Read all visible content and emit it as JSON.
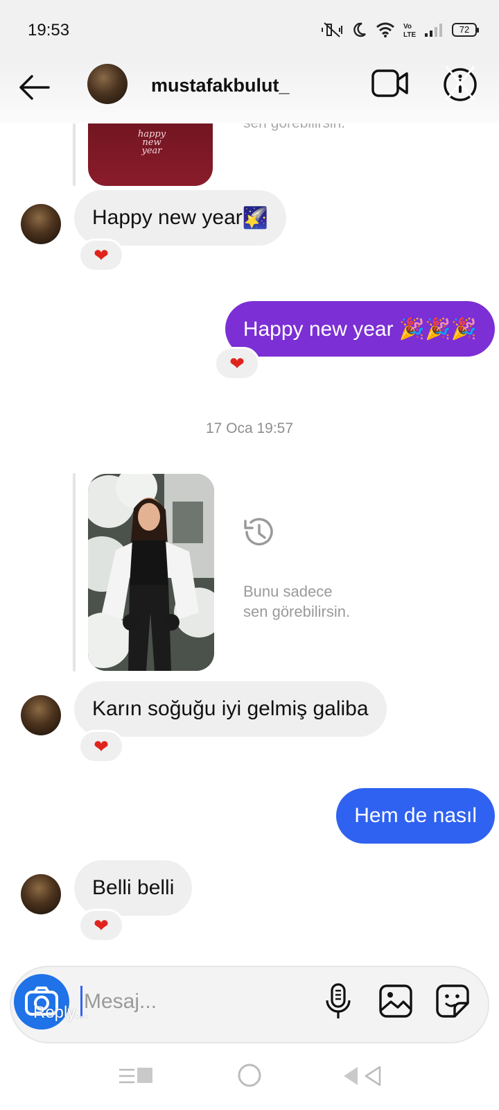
{
  "status_bar": {
    "time": "19:53",
    "battery": "72",
    "icons": [
      "mute-icon",
      "moon-icon",
      "wifi-icon",
      "volte-icon",
      "signal-icon",
      "battery-icon"
    ]
  },
  "header": {
    "username": "mustafakbulut_",
    "icons": [
      "back-arrow-icon",
      "video-camera-icon",
      "info-icon"
    ]
  },
  "chat": {
    "story_top": {
      "card_text": "happy new year",
      "faded_text": "sen görebilirsin."
    },
    "messages": [
      {
        "id": "m1",
        "direction": "incoming",
        "text": "Happy new year",
        "emoji": "🌠",
        "reaction": "❤"
      },
      {
        "id": "m2",
        "direction": "outgoing",
        "text": "Happy new year 🎉🎉🎉",
        "color": "#7b2fd4",
        "reaction": "❤"
      },
      {
        "id": "m3",
        "direction": "incoming",
        "text": "Karın soğuğu iyi gelmiş galiba",
        "reaction": "❤"
      },
      {
        "id": "m4",
        "direction": "outgoing",
        "text": "Hem de nasıl",
        "color": "#2f62f0"
      },
      {
        "id": "m5",
        "direction": "incoming",
        "text": "Belli belli",
        "reaction": "❤"
      }
    ],
    "timestamp": "17 Oca 19:57",
    "story_reply": {
      "line1": "Bunu sadece",
      "line2": "sen görebilirsin.",
      "icon": "history-clock-icon"
    }
  },
  "composer": {
    "placeholder": "Mesaj...",
    "reply_overlay": "Reply...",
    "icons": [
      "camera-icon",
      "microphone-icon",
      "gallery-icon",
      "sticker-icon"
    ],
    "accent_color": "#1f72e8"
  },
  "nav_bar": {
    "icons": [
      "menu-icon",
      "home-circle-icon",
      "back-triangle-icon"
    ]
  }
}
